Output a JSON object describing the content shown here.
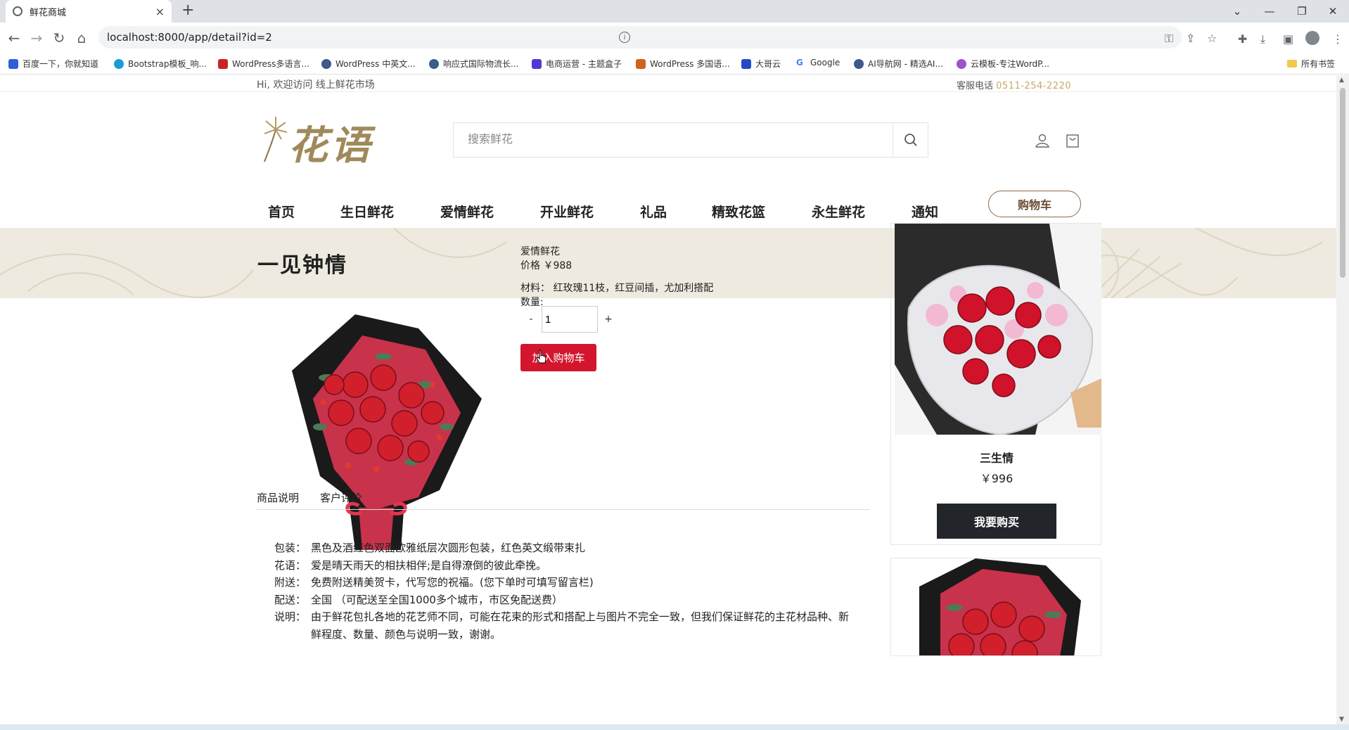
{
  "browser": {
    "tab_title": "鲜花商城",
    "tab_close": "×",
    "new_tab": "+",
    "url": "localhost:8000/app/detail?id=2",
    "bookmarks": [
      "百度一下，你就知道",
      "Bootstrap模板_响...",
      "WordPress多语言...",
      "WordPress 中英文...",
      "响应式国际物流长...",
      "电商运营 - 主题盒子",
      "WordPress 多国语...",
      "大哥云",
      "Google",
      "AI导航网 - 精选AI...",
      "云模板-专注WordP..."
    ],
    "bookmarks_folder": "所有书签"
  },
  "topbar": {
    "welcome": "Hi, 欢迎访问 线上鲜花市场",
    "phone_label": "客服电话",
    "phone_number": "0511-254-2220"
  },
  "header": {
    "logo_text": "花语",
    "search_placeholder": "搜索鲜花"
  },
  "nav": {
    "items": [
      "首页",
      "生日鲜花",
      "爱情鲜花",
      "开业鲜花",
      "礼品",
      "精致花篮",
      "永生鲜花",
      "通知"
    ],
    "cart": "购物车"
  },
  "banner": {
    "title": "一见钟情"
  },
  "product": {
    "category": "爱情鲜花",
    "price_label": "价格",
    "price": "￥988",
    "material_label": "材料：",
    "material": "红玫瑰11枝，红豆间插，尤加利搭配",
    "qty_label": "数量:",
    "qty_minus": "-",
    "qty_value": "1",
    "qty_plus": "+",
    "add_to_cart": "加入购物车"
  },
  "detail_tabs": [
    "商品说明",
    "客户评价"
  ],
  "description": [
    {
      "k": "包装：",
      "v": "黑色及酒红色双面欧雅纸层次圆形包装，红色英文缎带束扎"
    },
    {
      "k": "花语：",
      "v": "爱是晴天雨天的相扶相伴;是自得潦倒的彼此牵挽。"
    },
    {
      "k": "附送：",
      "v": "免费附送精美贺卡，代写您的祝福。(您下单时可填写留言栏)"
    },
    {
      "k": "配送：",
      "v": "全国 （可配送至全国1000多个城市，市区免配送费）"
    },
    {
      "k": "说明：",
      "v": "由于鲜花包扎各地的花艺师不同，可能在花束的形式和搭配上与图片不完全一致，但我们保证鲜花的主花材品种、新鲜程度、数量、颜色与说明一致，谢谢。"
    }
  ],
  "recommend": {
    "name": "三生情",
    "price": "￥996",
    "buy": "我要购买"
  }
}
